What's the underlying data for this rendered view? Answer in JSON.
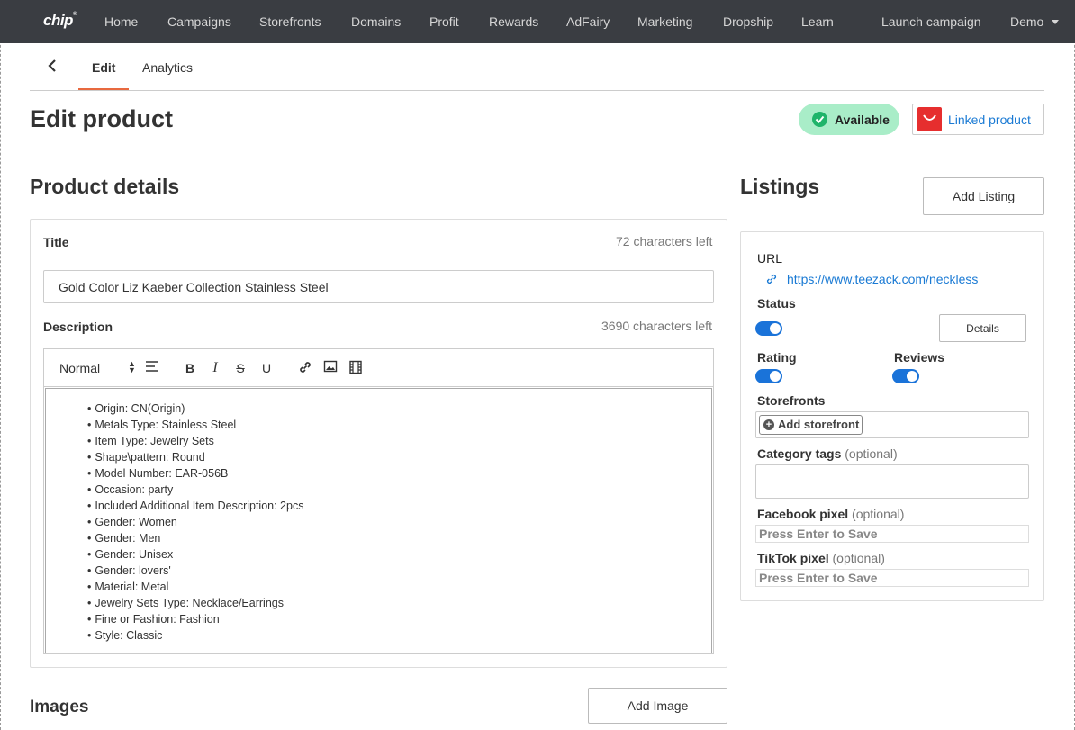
{
  "nav": {
    "logo": "chip",
    "logo_mark": "®",
    "items": [
      "Home",
      "Campaigns",
      "Storefronts",
      "Domains",
      "Profit",
      "Rewards",
      "AdFairy",
      "Marketing",
      "Dropship",
      "Learn"
    ],
    "launch": "Launch campaign",
    "account": "Demo"
  },
  "tabs": {
    "edit": "Edit",
    "analytics": "Analytics"
  },
  "header": {
    "title": "Edit product",
    "status": "Available",
    "linked": "Linked product"
  },
  "product": {
    "section_title": "Product details",
    "title_label": "Title",
    "title_hint": "72 characters left",
    "title_value": "Gold Color Liz Kaeber Collection Stainless Steel",
    "desc_label": "Description",
    "desc_hint": "3690 characters left",
    "format": "Normal",
    "description_items": [
      "Origin: CN(Origin)",
      "Metals Type: Stainless Steel",
      "Item Type: Jewelry Sets",
      "Shape\\pattern: Round",
      "Model Number: EAR-056B",
      "Occasion: party",
      "Included Additional Item Description: 2pcs",
      "Gender: Women",
      "Gender: Men",
      "Gender: Unisex",
      "Gender: lovers'",
      "Material: Metal",
      "Jewelry Sets Type: Necklace/Earrings",
      "Fine or Fashion: Fashion",
      "Style: Classic"
    ]
  },
  "images": {
    "section_title": "Images",
    "add_button": "Add Image"
  },
  "listings": {
    "section_title": "Listings",
    "add_button": "Add Listing",
    "url_label": "URL",
    "url": "https://www.teezack.com/neckless",
    "status_label": "Status",
    "details_button": "Details",
    "rating_label": "Rating",
    "reviews_label": "Reviews",
    "storefronts_label": "Storefronts",
    "add_storefront": "Add storefront",
    "category_label": "Category tags",
    "optional": "(optional)",
    "facebook_label": "Facebook pixel",
    "tiktok_label": "TikTok pixel",
    "pixel_placeholder": "Press Enter to Save",
    "status_on": true,
    "rating_on": true,
    "reviews_on": true
  },
  "colors": {
    "accent": "#e8693f",
    "nav_bg": "#3a3d42",
    "link": "#1a7ad4",
    "toggle": "#1a73d9",
    "available_bg": "#a9edc8"
  }
}
